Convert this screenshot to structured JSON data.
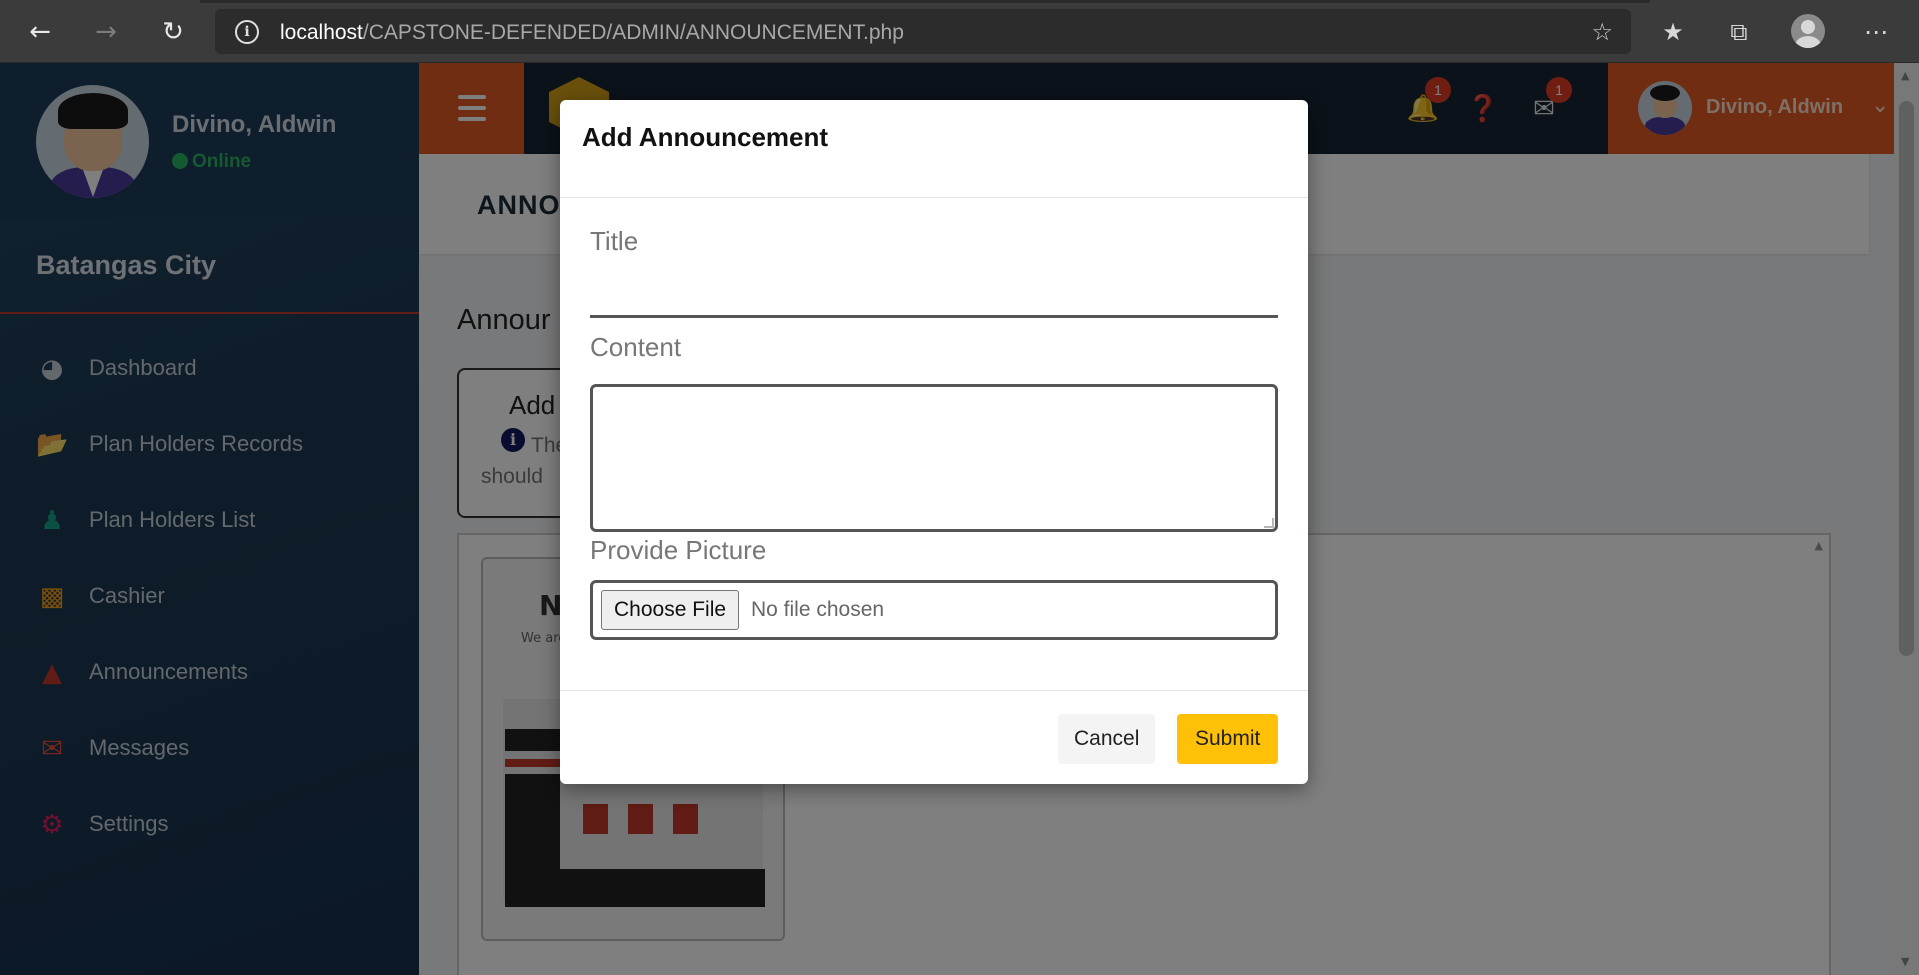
{
  "browser": {
    "url_host": "localhost",
    "url_path": "/CAPSTONE-DEFENDED/ADMIN/ANNOUNCEMENT.php",
    "icons": [
      "back-arrow-icon",
      "forward-arrow-icon",
      "reload-icon",
      "site-info-icon",
      "add-favorite-icon",
      "favorites-icon",
      "collections-icon",
      "profile-icon",
      "more-icon"
    ]
  },
  "sidebar": {
    "user_name": "Divino, Aldwin",
    "status": "Online",
    "city": "Batangas City",
    "items": [
      {
        "label": "Dashboard",
        "icon": "dashboard-icon",
        "color": "#c6d0da"
      },
      {
        "label": "Plan Holders Records",
        "icon": "folder-open-icon",
        "color": "#8e44ad"
      },
      {
        "label": "Plan Holders List",
        "icon": "users-icon",
        "color": "#16a085"
      },
      {
        "label": "Cashier",
        "icon": "money-bill-icon",
        "color": "#f39c12"
      },
      {
        "label": "Announcements",
        "icon": "bullhorn-icon",
        "color": "#c0392b"
      },
      {
        "label": "Messages",
        "icon": "envelope-icon",
        "color": "#e74c3c"
      },
      {
        "label": "Settings",
        "icon": "gear-icon",
        "color": "#e91e63"
      }
    ]
  },
  "topbar": {
    "notification_count": "1",
    "message_count": "1",
    "user_name": "Divino, Aldwin",
    "accent_color": "#e05a23"
  },
  "main": {
    "page_title": "ANNO",
    "section_title": "Annour",
    "add_card_title": "Add",
    "add_card_text_line1": "The",
    "add_card_text_line2": "should",
    "thumb_heading": "Ne",
    "thumb_subtext": "We are p"
  },
  "modal": {
    "title": "Add Announcement",
    "title_label": "Title",
    "title_value": "",
    "content_label": "Content",
    "content_value": "",
    "picture_label": "Provide Picture",
    "choose_file_label": "Choose File",
    "file_status": "No file chosen",
    "cancel_label": "Cancel",
    "submit_label": "Submit",
    "submit_color": "#ffc107"
  }
}
